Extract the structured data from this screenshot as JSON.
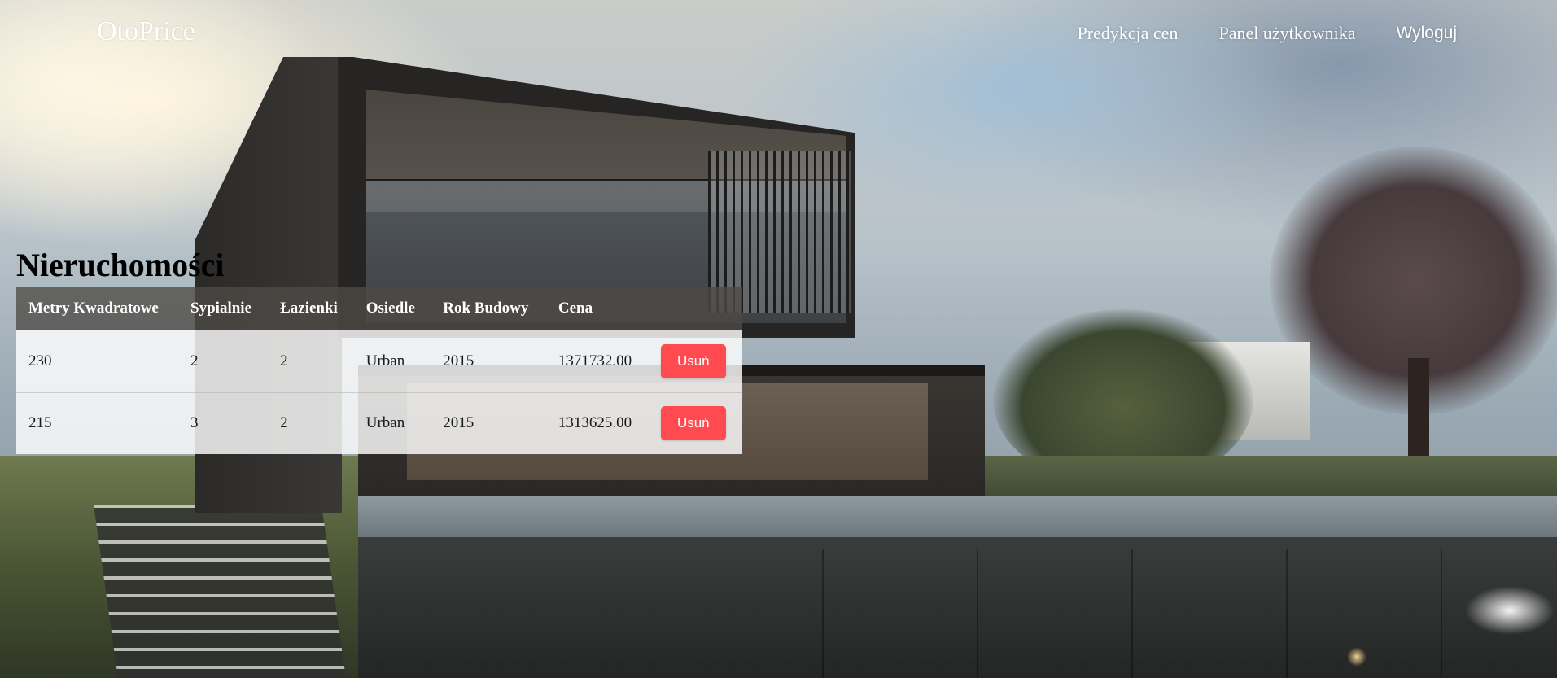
{
  "navbar": {
    "brand": "OtoPrice",
    "links": [
      {
        "label": "Predykcja cen"
      },
      {
        "label": "Panel użytkownika"
      },
      {
        "label": "Wyloguj"
      }
    ]
  },
  "page": {
    "title": "Nieruchomości"
  },
  "table": {
    "headers": [
      "Metry Kwadratowe",
      "Sypialnie",
      "Łazienki",
      "Osiedle",
      "Rok Budowy",
      "Cena",
      ""
    ],
    "rows": [
      {
        "sqm": "230",
        "bedrooms": "2",
        "bathrooms": "2",
        "district": "Urban",
        "year": "2015",
        "price": "1371732.00",
        "action": "Usuń"
      },
      {
        "sqm": "215",
        "bedrooms": "3",
        "bathrooms": "2",
        "district": "Urban",
        "year": "2015",
        "price": "1313625.00",
        "action": "Usuń"
      }
    ]
  },
  "colors": {
    "delete_button": "#ff4b4f",
    "header_bg": "#4e4a46",
    "nav_text": "#ffffff"
  }
}
